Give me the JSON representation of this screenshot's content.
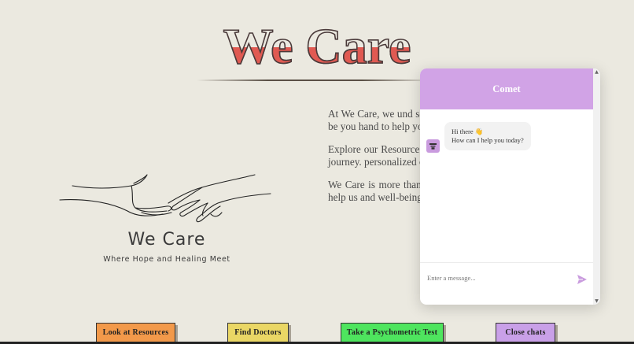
{
  "hero": {
    "title": "We Care",
    "colors": {
      "outline": "#4a3a3a",
      "fill": "#e05a52",
      "bg": "#ebe9e0"
    }
  },
  "logo": {
    "title": "We Care",
    "tagline": "Where Hope and Healing Meet",
    "icon": "reaching-hands-icon"
  },
  "about": {
    "paragraphs": [
      "At We Care, we und sometimes navigating We're here to be you hand to help you find y",
      "Explore our Resource tools, and tips designe well-being journey. personalized compass understanding.",
      "We Care is more than you can blossom ar support, and help us and well-being."
    ]
  },
  "chat": {
    "title": "Comet",
    "greeting_line1": "Hi there 👋",
    "greeting_line2": "How can I help you today?",
    "input_placeholder": "Enter a message...",
    "accent": "#d1a3e6"
  },
  "buttons": {
    "resources": "Look at Resources",
    "doctors": "Find Doctors",
    "test": "Take a Psychometric Test",
    "close": "Close chats"
  }
}
